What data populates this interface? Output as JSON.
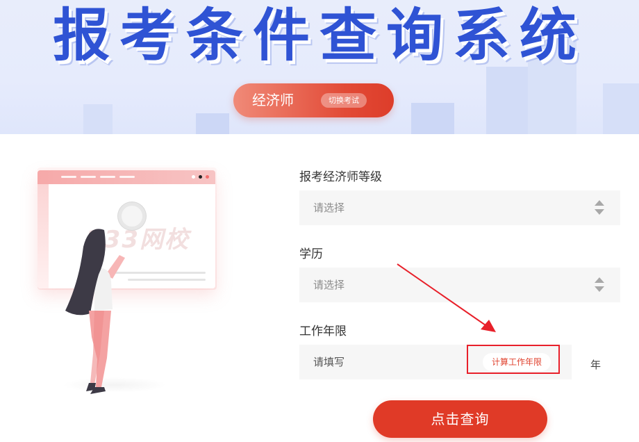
{
  "banner": {
    "title": "报考条件查询系统",
    "exam_name": "经济师",
    "switch_label": "切换考试"
  },
  "illustration": {
    "watermark": "233网校"
  },
  "form": {
    "level": {
      "label": "报考经济师等级",
      "placeholder": "请选择"
    },
    "education": {
      "label": "学历",
      "placeholder": "请选择"
    },
    "work_years": {
      "label": "工作年限",
      "placeholder": "请填写",
      "calc_button": "计算工作年限",
      "unit": "年"
    },
    "submit_label": "点击查询"
  },
  "colors": {
    "brand_red": "#e03a27",
    "title_blue": "#2f53d4",
    "highlight_red": "#e8202a"
  }
}
